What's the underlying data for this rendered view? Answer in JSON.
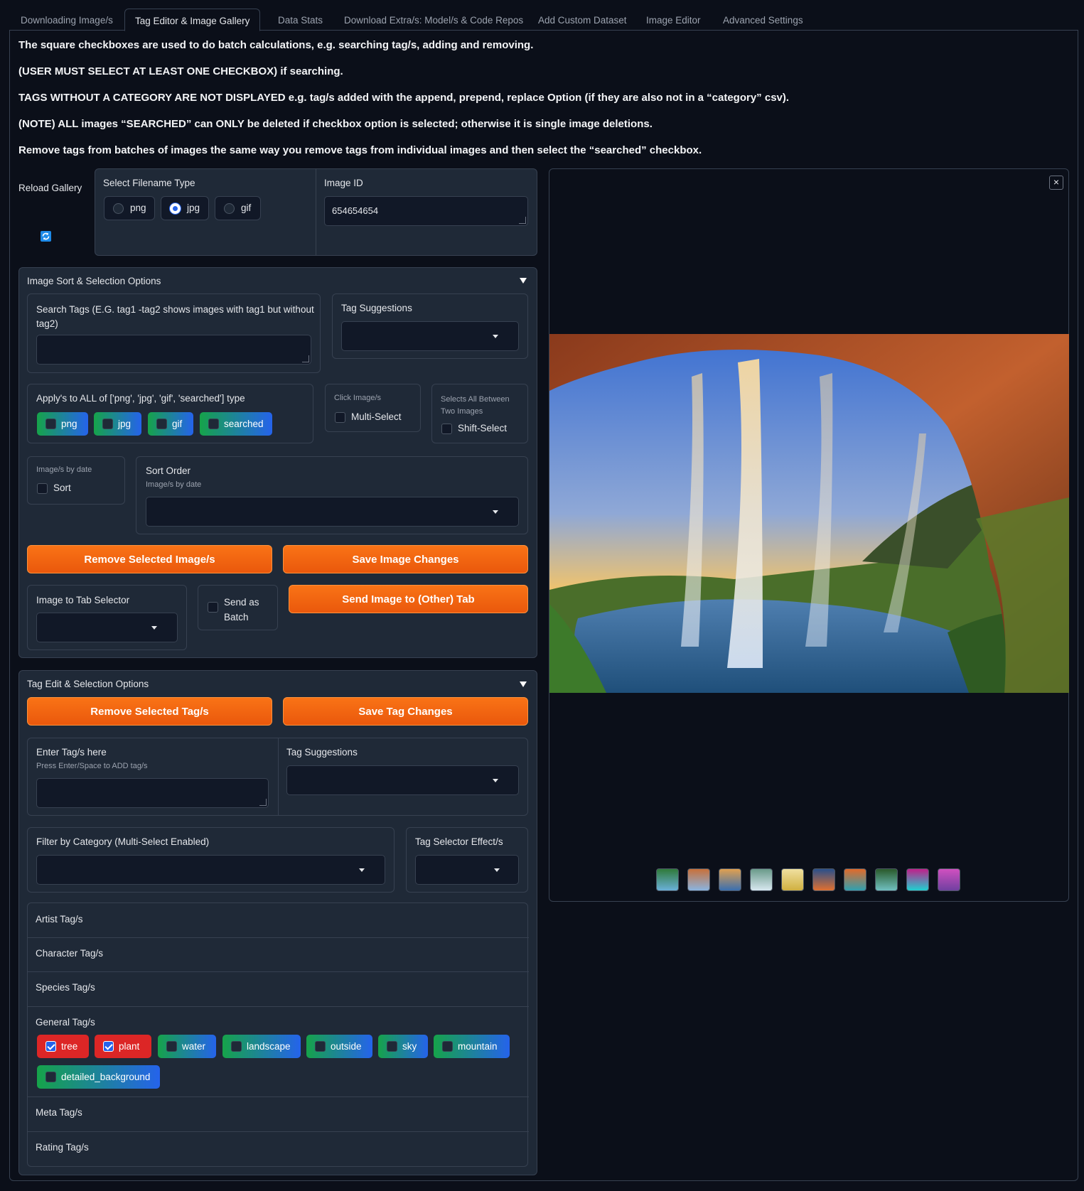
{
  "tabs": [
    "Downloading Image/s",
    "Tag Editor & Image Gallery",
    "Data Stats",
    "Download Extra/s: Model/s & Code Repos",
    "Add Custom Dataset",
    "Image Editor",
    "Advanced Settings"
  ],
  "notes": [
    "The square checkboxes are used to do batch calculations, e.g. searching tag/s, adding and removing.",
    "(USER MUST SELECT AT LEAST ONE CHECKBOX) if searching.",
    "TAGS WITHOUT A CATEGORY ARE NOT DISPLAYED e.g. tag/s added with the append, prepend, replace Option (if they are also not in a “category” csv).",
    "(NOTE) ALL images “SEARCHED” can ONLY be deleted if checkbox option is selected; otherwise it is single image deletions.",
    "Remove tags from batches of images the same way you remove tags from individual images and then select the “searched” checkbox."
  ],
  "reload": {
    "label": "Reload Gallery"
  },
  "filename": {
    "label": "Select Filename Type",
    "options": [
      "png",
      "jpg",
      "gif"
    ],
    "selected": "jpg"
  },
  "image_id": {
    "label": "Image ID",
    "value": "654654654"
  },
  "sort_section": {
    "title": "Image Sort & Selection Options",
    "search_label": "Search Tags (E.G. tag1 -tag2 shows images with tag1 but without tag2)",
    "search_label_l1": "Search Tags (E.G. tag1 -tag2 shows images with tag1 but without",
    "search_label_l2": "tag2)",
    "tag_suggestions": "Tag Suggestions",
    "apply_label": "Apply's to ALL of ['png', 'jpg', 'gif', 'searched'] type",
    "apply_chips": [
      "png",
      "jpg",
      "gif",
      "searched"
    ],
    "click_label": "Click Image/s",
    "multi_select": "Multi-Select",
    "shift_label_l1": "Selects All Between",
    "shift_label_l2": "Two Images",
    "shift_select": "Shift-Select",
    "by_date_label": "Image/s by date",
    "sort": "Sort",
    "sort_order": "Sort Order",
    "sort_order_sub": "Image/s by date",
    "remove_images": "Remove Selected Image/s",
    "save_images": "Save Image Changes",
    "tab_selector": "Image to Tab Selector",
    "send_batch_l1": "Send as",
    "send_batch_l2": "Batch",
    "send_image": "Send Image to (Other) Tab"
  },
  "tag_section": {
    "title": "Tag Edit & Selection Options",
    "remove_tags": "Remove Selected Tag/s",
    "save_tags": "Save Tag Changes",
    "enter_label": "Enter Tag/s here",
    "enter_sub": "Press Enter/Space to ADD tag/s",
    "tag_suggestions": "Tag Suggestions",
    "filter_label": "Filter by Category (Multi-Select Enabled)",
    "effect_label": "Tag Selector Effect/s",
    "categories": [
      "Artist Tag/s",
      "Character Tag/s",
      "Species Tag/s",
      "General Tag/s",
      "Meta Tag/s",
      "Rating Tag/s"
    ],
    "general_tags": [
      {
        "name": "tree",
        "checked": true
      },
      {
        "name": "plant",
        "checked": true
      },
      {
        "name": "water",
        "checked": false
      },
      {
        "name": "landscape",
        "checked": false
      },
      {
        "name": "outside",
        "checked": false
      },
      {
        "name": "sky",
        "checked": false
      },
      {
        "name": "mountain",
        "checked": false
      },
      {
        "name": "detailed_background",
        "checked": false
      }
    ]
  },
  "gallery": {
    "thumb_count": 10,
    "close_icon": "close-icon"
  },
  "colors": {
    "accent": "#f97316",
    "bg": "#0b0f19",
    "panel": "#1f2937",
    "checked_tag": "#dc2626"
  }
}
